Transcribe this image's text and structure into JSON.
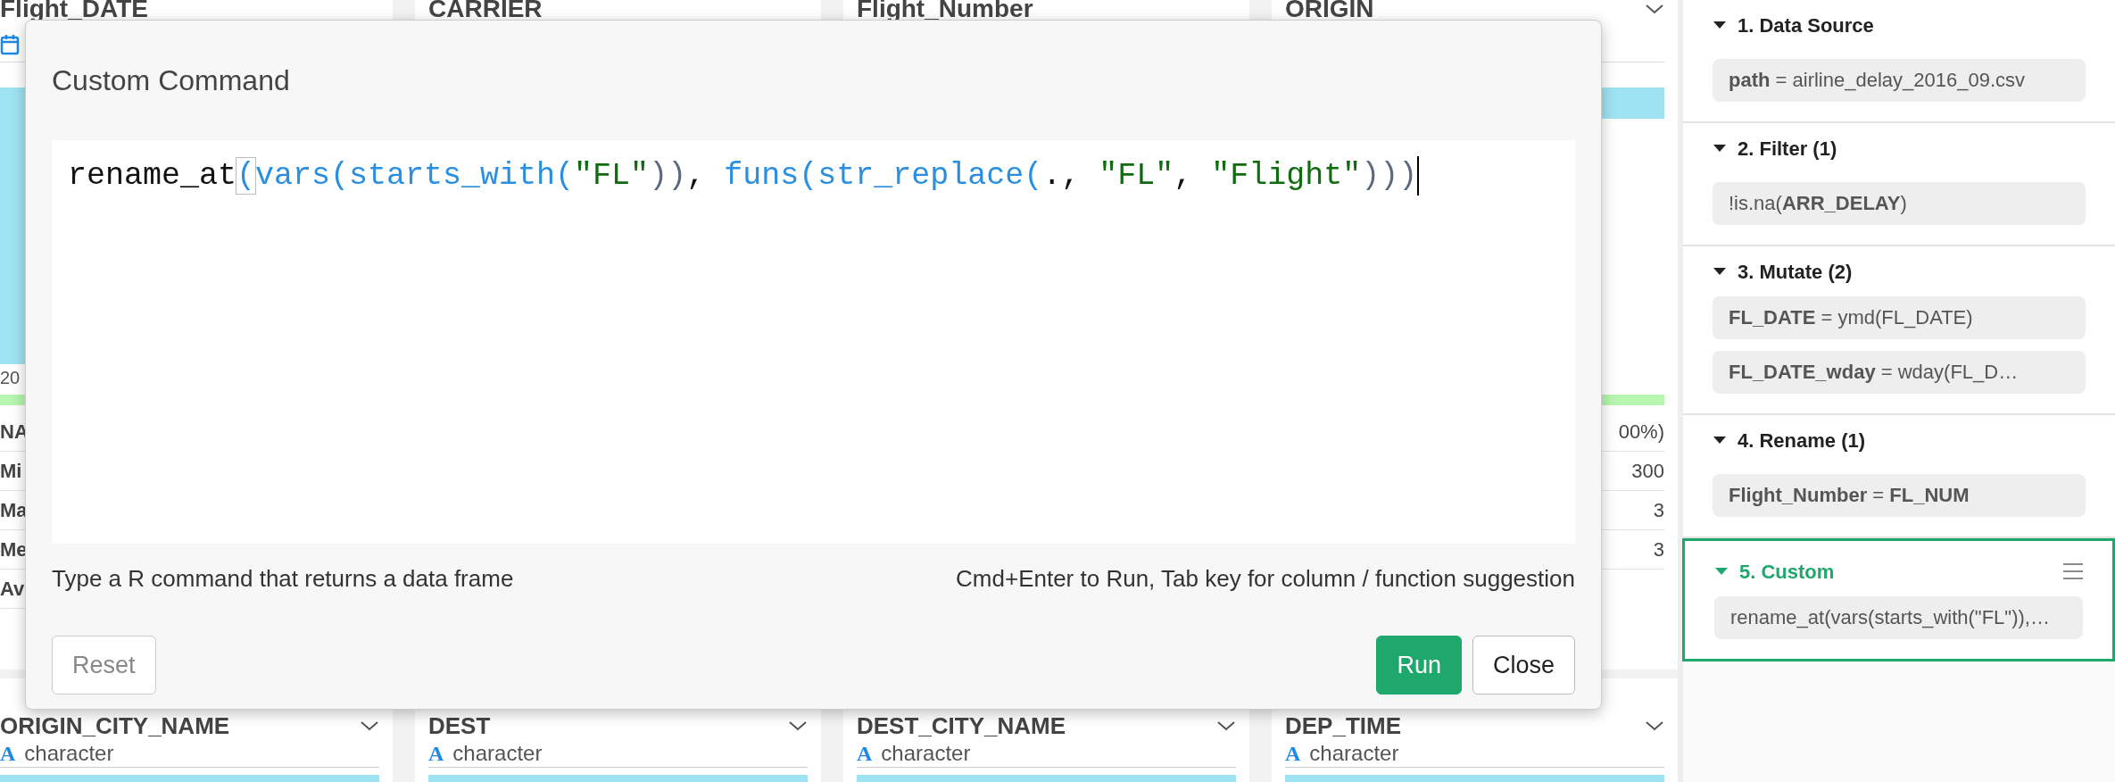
{
  "columns_top": [
    {
      "name": "Flight_DATE",
      "date_icon": true,
      "axis_label": "20",
      "stat_labels": [
        "NA",
        "Mi",
        "Ma",
        "Me",
        "Av"
      ]
    },
    {
      "name": "CARRIER"
    },
    {
      "name": "Flight_Number"
    },
    {
      "name": "ORIGIN",
      "menu_icon": true,
      "stat_values": [
        "00%)",
        "300",
        "3",
        "3"
      ]
    }
  ],
  "columns_bottom": [
    {
      "name": "ORIGIN_CITY_NAME",
      "type_glyph": "A",
      "type_label": "character",
      "menu_icon": true
    },
    {
      "name": "DEST",
      "type_glyph": "A",
      "type_label": "character",
      "menu_icon": true
    },
    {
      "name": "DEST_CITY_NAME",
      "type_glyph": "A",
      "type_label": "character",
      "menu_icon": true
    },
    {
      "name": "DEP_TIME",
      "type_glyph": "A",
      "type_label": "character",
      "menu_icon": true
    }
  ],
  "dialog": {
    "title": "Custom Command",
    "code": [
      {
        "kind": "plain",
        "text": "rename_at"
      },
      {
        "kind": "bracket",
        "text": "("
      },
      {
        "kind": "func",
        "text": "vars(starts_with("
      },
      {
        "kind": "string",
        "text": "\"FL\""
      },
      {
        "kind": "paren",
        "text": "))"
      },
      {
        "kind": "plain",
        "text": ", "
      },
      {
        "kind": "func",
        "text": "funs(str_replace("
      },
      {
        "kind": "plain",
        "text": "., "
      },
      {
        "kind": "string",
        "text": "\"FL\""
      },
      {
        "kind": "plain",
        "text": ", "
      },
      {
        "kind": "string",
        "text": "\"Flight\""
      },
      {
        "kind": "paren",
        "text": ")))"
      }
    ],
    "hint_left": "Type a R command that returns a data frame",
    "hint_right": "Cmd+Enter to Run, Tab key for column / function suggestion",
    "buttons": [
      {
        "label": "Reset",
        "kind": "reset"
      },
      {
        "label": "Run",
        "kind": "primary"
      },
      {
        "label": "Close",
        "kind": "secondary"
      }
    ]
  },
  "steps": [
    {
      "title": "1. Data Source",
      "expanded": true,
      "selected": false,
      "items": [
        "**path** = airline_delay_2016_09.csv"
      ]
    },
    {
      "title": "2. Filter (1)",
      "expanded": true,
      "selected": false,
      "items": [
        "!is.na(**ARR_DELAY**)"
      ]
    },
    {
      "title": "3. Mutate (2)",
      "expanded": true,
      "selected": false,
      "items": [
        "**FL_DATE** = ymd(FL_DATE)",
        "**FL_DATE_wday** = wday(FL_D…"
      ]
    },
    {
      "title": "4. Rename (1)",
      "expanded": true,
      "selected": false,
      "items": [
        "**Flight_Number** = **FL_NUM**"
      ]
    },
    {
      "title": "5. Custom",
      "expanded": true,
      "selected": true,
      "items": [
        "rename_at(vars(starts_with(\"FL\")),…"
      ]
    }
  ]
}
